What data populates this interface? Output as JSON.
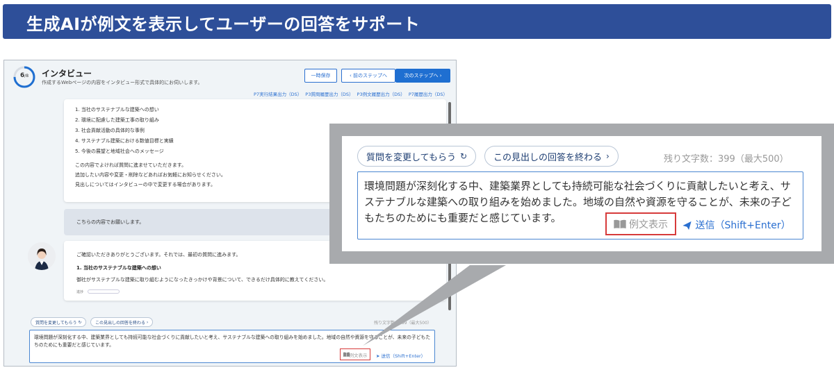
{
  "banner": {
    "title": "生成AIが例文を表示してユーザーの回答をサポート"
  },
  "app": {
    "progress": {
      "current": "6",
      "total": "/8"
    },
    "title": "インタビュー",
    "subtitle": "作成するWebページの内容をインタビュー形式で具体的にお伺いします。",
    "buttons": {
      "save": "一時保存",
      "prev": "前のステップへ",
      "next": "次のステップへ"
    },
    "links": [
      "P7実行結果出力（DS）",
      "P3質問履歴出力（DS）",
      "P3例文履歴出力（DS）",
      "P7履歴出力（DS）"
    ],
    "topics": [
      "1. 当社のサステナブルな建築への想い",
      "2. 環境に配慮した建築工事の取り組み",
      "3. 社会貢献活動の具体的な事例",
      "4. サステナブル建築における数値目標と実績",
      "5. 今後の展望と地域社会へのメッセージ"
    ],
    "notes": [
      "この内容でよければ質問に進ませていただきます。",
      "追加したい内容や変更・削除などあればお気軽にお知らせください。",
      "見出しについてはインタビューの中で変更する場合があります。"
    ],
    "user_request": "こちらの内容でお願いします。",
    "ai_message": {
      "intro": "ご確認いただきありがとうございます。それでは、最初の質問に進みます。",
      "heading": "1. 当社のサステナブルな建築への想い",
      "question": "御社がサステナブルな建築に取り組むようになったきっかけや背景について、できるだけ具体的に教えてください。",
      "progress_label": "進捗"
    },
    "chips": {
      "change": "質問を変更してもらう",
      "end": "この見出しの回答を終わる"
    },
    "remaining": "残り文字数：399（最大500）",
    "answer": "環境問題が深刻化する中、建築業界としても持続可能な社会づくりに貢献したいと考え、サステナブルな建築への取り組みを始めました。地域の自然や資源を守ることが、未来の子どもたちのためにも重要だと感じています。",
    "example_button": "例文表示",
    "send_button": "送信（Shift+Enter）"
  },
  "zoom": {
    "chips": {
      "change": "質問を変更してもらう",
      "end": "この見出しの回答を終わる"
    },
    "remaining": "残り文字数：399（最大500）",
    "answer": "環境問題が深刻化する中、建築業界としても持続可能な社会づくりに貢献したいと考え、サステナブルな建築への取り組みを始めました。地域の自然や資源を守ることが、未来の子どもたちのためにも重要だと感じています。",
    "example_button": "例文表示",
    "send_button": "送信（Shift+Enter）"
  },
  "colors": {
    "banner": "#2e4f99",
    "accent": "#1f6fd1",
    "highlight": "#d63a3a"
  }
}
